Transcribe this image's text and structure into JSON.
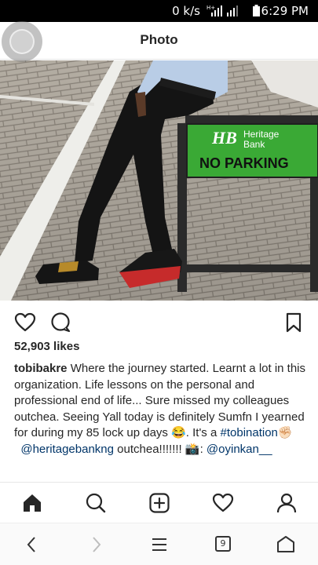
{
  "status_bar": {
    "network_speed": "0 k/s",
    "network_type": "H+",
    "time": "6:29 PM"
  },
  "header": {
    "title": "Photo"
  },
  "photo": {
    "sign_brand": "Heritage Bank",
    "sign_brand_line1": "Heritage",
    "sign_brand_line2": "Bank",
    "sign_text": "NO PARKING",
    "sign_logo": "HB",
    "sign_color": "#3aa935"
  },
  "post": {
    "likes": "52,903 likes",
    "username": "tobibakre",
    "caption_text": "Where the journey started. Learnt a lot in this organization. Life lessons on the personal and professional end of life... Sure missed my colleagues outchea. Seeing Yall today is definitely Sumfn I yearned for during my 85 lock up days 😂. It's a",
    "hashtag": "#tobination",
    "hashtag_emoji": "✊🏻",
    "mention1": "@heritagebankng",
    "after_mention": " outchea!!!!!!! ",
    "camera_emoji": "📸",
    "colon": ":",
    "mention2": "@oyinkan__"
  },
  "action_icons": [
    "heart-icon",
    "comment-icon",
    "bookmark-icon"
  ],
  "bottom_nav": [
    "home-icon",
    "search-icon",
    "add-post-icon",
    "activity-heart-icon",
    "profile-icon"
  ],
  "system_nav": {
    "tab_count": "9"
  },
  "colors": {
    "link": "#003569",
    "text": "#262626",
    "sign_green": "#3aa935"
  }
}
